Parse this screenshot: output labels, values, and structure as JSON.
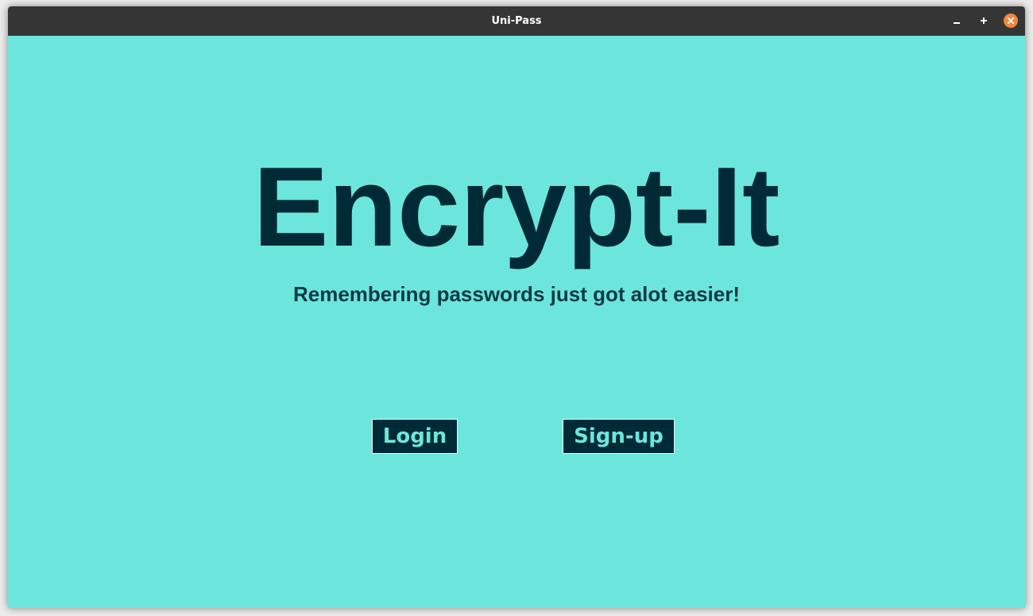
{
  "window": {
    "title": "Uni-Pass",
    "controls": {
      "minimize_icon": "minimize-icon",
      "maximize_icon": "maximize-icon",
      "close_icon": "close-icon",
      "close_color": "#f0883e"
    }
  },
  "main": {
    "title": "Encrypt-It",
    "subtitle": "Remembering passwords just got alot easier!",
    "login_label": "Login",
    "signup_label": "Sign-up"
  },
  "colors": {
    "background": "#6ce6dc",
    "text": "#002b36",
    "button_bg": "#002b36",
    "button_text": "#6ce6dc",
    "titlebar": "#353535"
  }
}
